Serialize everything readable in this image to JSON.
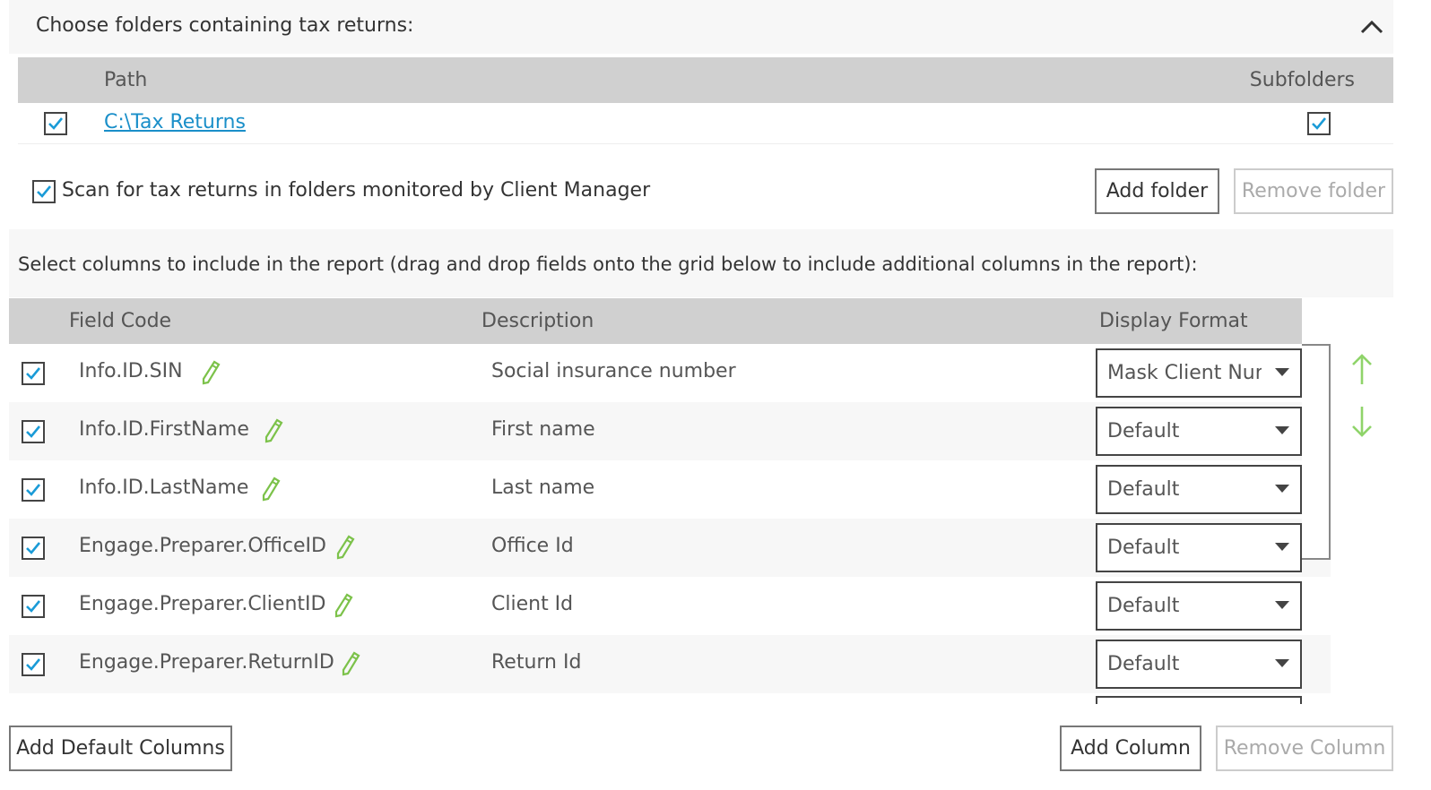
{
  "folders_section": {
    "title": "Choose folders containing tax returns:",
    "grid_headers": {
      "path": "Path",
      "subfolders": "Subfolders"
    },
    "rows": [
      {
        "path": "C:\\Tax Returns",
        "checked": true,
        "subfolders": true
      }
    ]
  },
  "scan_option": {
    "label": "Scan for tax returns in folders monitored by Client Manager",
    "checked": true
  },
  "folder_buttons": {
    "add": "Add folder",
    "remove": "Remove folder"
  },
  "columns_section": {
    "title": "Select columns to include in the report (drag and drop fields onto the grid below to include additional columns in the report):",
    "grid_headers": {
      "field_code": "Field Code",
      "description": "Description",
      "display_format": "Display Format"
    },
    "rows": [
      {
        "field_code": "Info.ID.SIN",
        "description": "Social insurance number",
        "display_format": "Mask Client Number",
        "checked": true
      },
      {
        "field_code": "Info.ID.FirstName",
        "description": "First name",
        "display_format": "Default",
        "checked": true
      },
      {
        "field_code": "Info.ID.LastName",
        "description": "Last name",
        "display_format": "Default",
        "checked": true
      },
      {
        "field_code": "Engage.Preparer.OfficeID",
        "description": "Office Id",
        "display_format": "Default",
        "checked": true
      },
      {
        "field_code": "Engage.Preparer.ClientID",
        "description": "Client Id",
        "display_format": "Default",
        "checked": true
      },
      {
        "field_code": "Engage.Preparer.ReturnID",
        "description": "Return Id",
        "display_format": "Default",
        "checked": true
      }
    ]
  },
  "column_buttons": {
    "add_default": "Add Default Columns",
    "add": "Add Column",
    "remove": "Remove Column"
  },
  "colors": {
    "accent_link": "#1a8fc9",
    "check": "#1a9bd7",
    "pencil": "#7cc24a",
    "move_arrows": "#8fd46a",
    "header_bg": "#d0d0d0"
  },
  "icons": {
    "collapse": "chevron-up-icon",
    "edit": "pencil-icon",
    "move_up": "arrow-up-icon",
    "move_down": "arrow-down-icon",
    "check": "checkmark-icon"
  }
}
